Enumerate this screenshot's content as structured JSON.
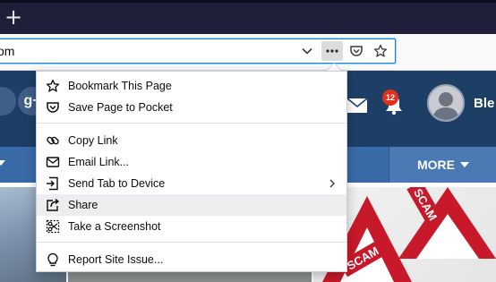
{
  "browser": {
    "new_tab_symbol": "+",
    "url_text": "om"
  },
  "page_action_menu": {
    "items": [
      {
        "label": "Bookmark This Page",
        "icon": "star-outline-icon"
      },
      {
        "label": "Save Page to Pocket",
        "icon": "pocket-icon"
      },
      {
        "label": "Copy Link",
        "icon": "link-icon"
      },
      {
        "label": "Email Link...",
        "icon": "email-icon"
      },
      {
        "label": "Send Tab to Device",
        "icon": "send-tab-icon",
        "has_submenu": true
      },
      {
        "label": "Share",
        "icon": "share-icon",
        "highlighted": true
      },
      {
        "label": "Take a Screenshot",
        "icon": "screenshot-icon"
      },
      {
        "label": "Report Site Issue...",
        "icon": "lightbulb-icon"
      }
    ]
  },
  "website": {
    "social_letters": "g+",
    "notification_count": "12",
    "user_name": "Ble",
    "more_label": "MORE",
    "image_text": [
      "SCAM",
      "SCAM"
    ]
  },
  "colors": {
    "tab_bar": "#1f1f3a",
    "url_focus": "#0a84ff",
    "site_header": "#1d3f66",
    "site_nav": "#3a6aa8",
    "badge": "#e0301e"
  }
}
